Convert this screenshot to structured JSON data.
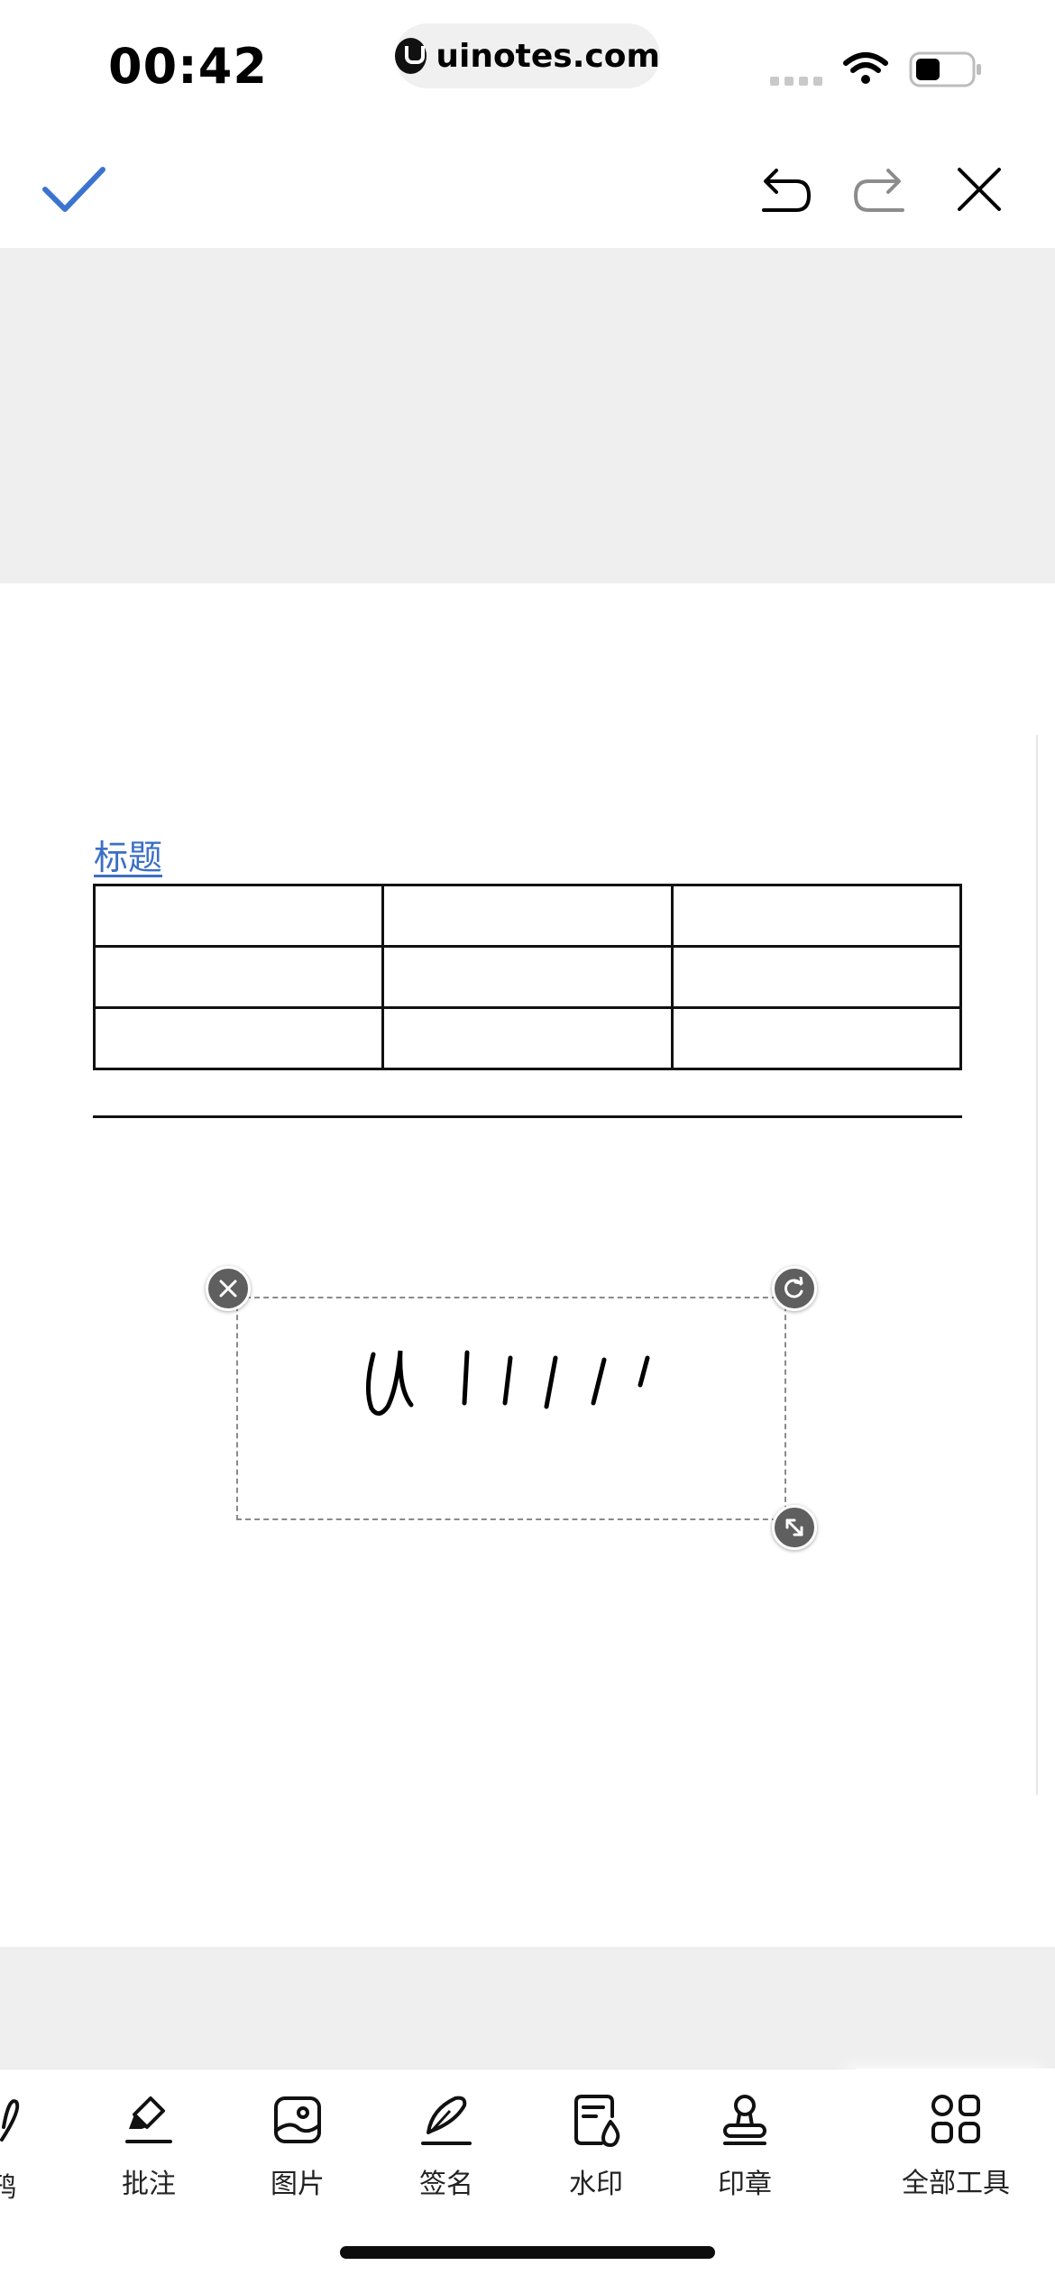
{
  "status_bar": {
    "time": "00:42",
    "url": "uinotes.com"
  },
  "toolbar": {
    "accent_color": "#3c73d0",
    "confirm_icon": "checkmark-icon",
    "undo_icon": "undo-icon",
    "redo_icon": "redo-icon",
    "close_icon": "close-icon"
  },
  "document": {
    "title": "标题",
    "table": {
      "rows": 3,
      "cols": 3
    },
    "signature_text": "Ulllll"
  },
  "bottom_tools": {
    "partial_label": "鸦",
    "items": [
      {
        "label": "批注",
        "icon": "highlighter-icon"
      },
      {
        "label": "图片",
        "icon": "image-icon"
      },
      {
        "label": "签名",
        "icon": "pen-signature-icon"
      },
      {
        "label": "水印",
        "icon": "watermark-icon"
      },
      {
        "label": "印章",
        "icon": "stamp-icon"
      }
    ],
    "all_tools_label": "全部工具"
  }
}
